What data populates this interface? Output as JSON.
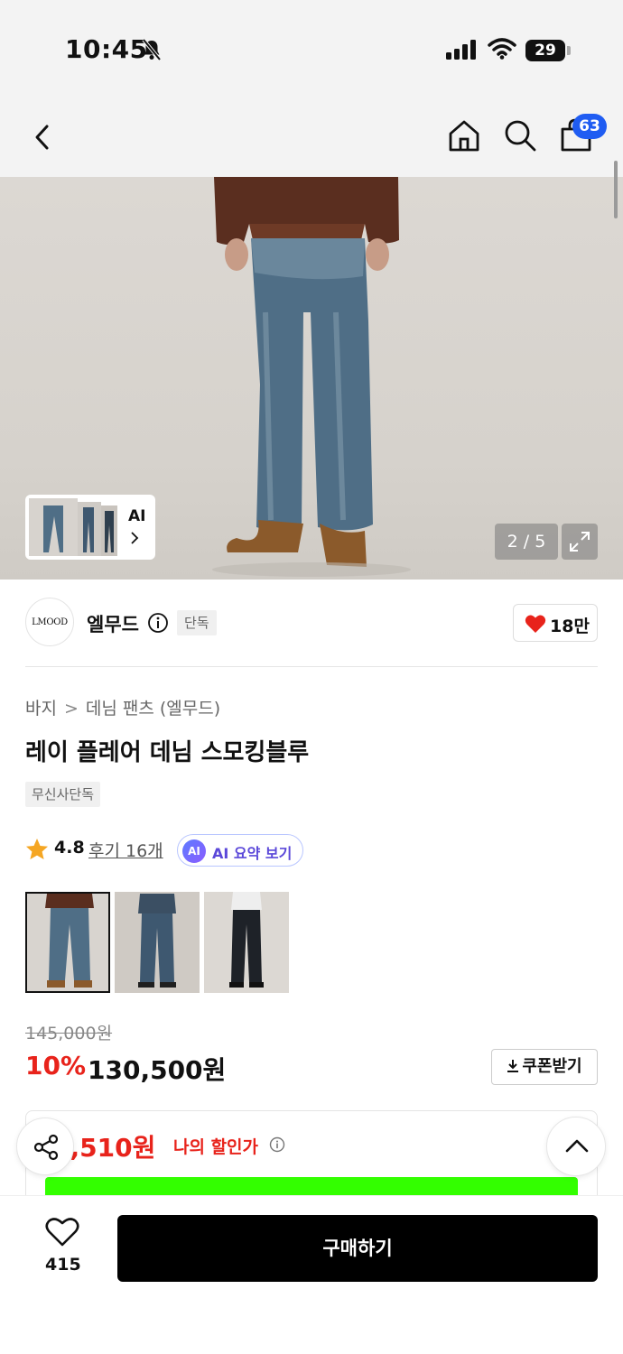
{
  "status_bar": {
    "time": "10:45",
    "battery": "29"
  },
  "header": {
    "cart_count": "63"
  },
  "gallery": {
    "ai_label": "AI",
    "counter": "2 / 5"
  },
  "brand": {
    "logo_text": "LMOOD",
    "name": "엘무드",
    "badge": "단독",
    "likes": "18만"
  },
  "product": {
    "breadcrumb": [
      "바지",
      "데님 팬츠 (엘무드)"
    ],
    "title": "레이 플레어 데님 스모킹블루",
    "tag": "무신사단독",
    "rating": "4.8",
    "reviews": "후기 16개",
    "ai_summary_icon": "AI",
    "ai_summary": "AI 요약 보기",
    "original_price": "145,000원",
    "discount": "10%",
    "price": "130,500원",
    "coupon_button": "쿠폰받기",
    "my_price_value": "1,510원",
    "my_price_label": "나의 할인가"
  },
  "bottom_bar": {
    "wish_count": "415",
    "buy_button": "구매하기"
  },
  "colors": {
    "accent_red": "#e8231b",
    "badge_blue": "#1f5cf2",
    "ai_purple": "#5b48d9",
    "banner_green": "#33ff00"
  }
}
